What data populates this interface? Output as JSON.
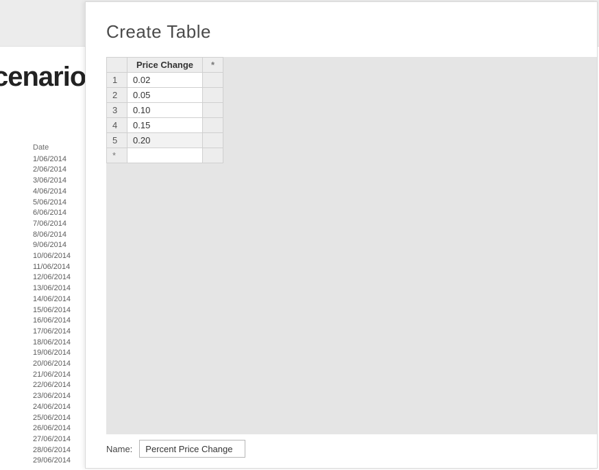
{
  "background": {
    "title_fragment": "cenario",
    "date_header": "Date",
    "dates": [
      "1/06/2014",
      "2/06/2014",
      "3/06/2014",
      "4/06/2014",
      "5/06/2014",
      "6/06/2014",
      "7/06/2014",
      "8/06/2014",
      "9/06/2014",
      "10/06/2014",
      "11/06/2014",
      "12/06/2014",
      "13/06/2014",
      "14/06/2014",
      "15/06/2014",
      "16/06/2014",
      "17/06/2014",
      "18/06/2014",
      "19/06/2014",
      "20/06/2014",
      "21/06/2014",
      "22/06/2014",
      "23/06/2014",
      "24/06/2014",
      "25/06/2014",
      "26/06/2014",
      "27/06/2014",
      "28/06/2014",
      "29/06/2014"
    ]
  },
  "dialog": {
    "title": "Create Table",
    "column_header": "Price Change",
    "add_column_symbol": "*",
    "new_row_symbol": "*",
    "rows": [
      {
        "n": "1",
        "value": "0.02"
      },
      {
        "n": "2",
        "value": "0.05"
      },
      {
        "n": "3",
        "value": "0.10"
      },
      {
        "n": "4",
        "value": "0.15"
      },
      {
        "n": "5",
        "value": "0.20"
      }
    ],
    "name_label": "Name:",
    "name_value": "Percent Price Change"
  }
}
